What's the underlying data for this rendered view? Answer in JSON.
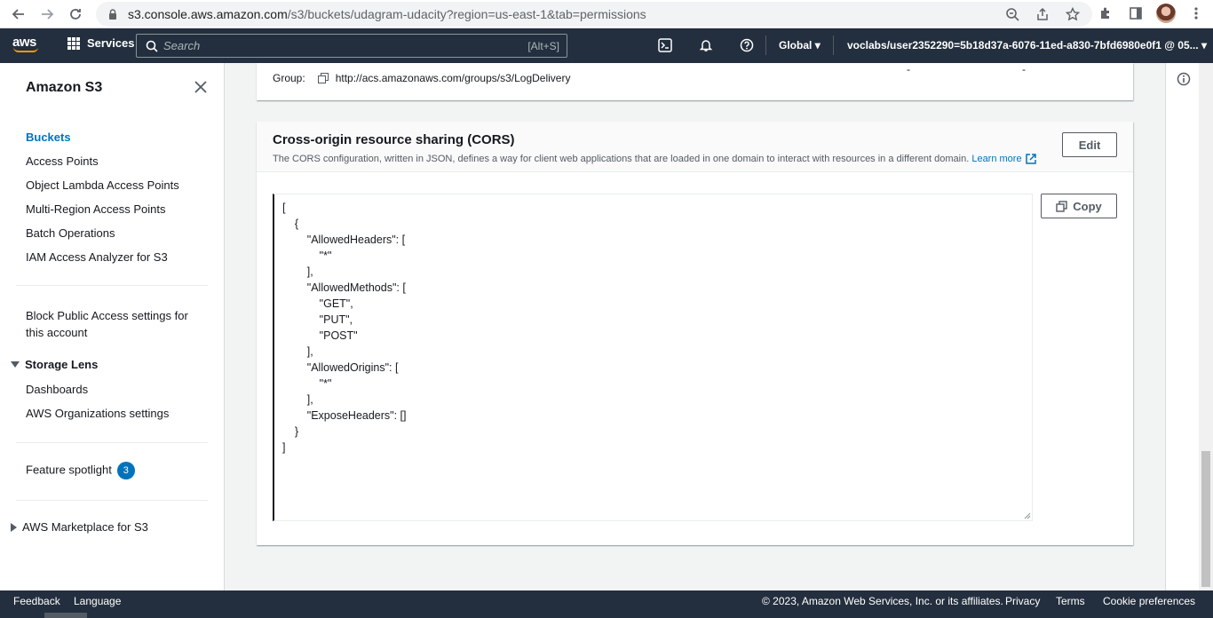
{
  "browser": {
    "url_host": "s3.console.aws.amazon.com",
    "url_rest": "/s3/buckets/udagram-udacity?region=us-east-1&tab=permissions"
  },
  "topnav": {
    "logo": "aws",
    "services_label": "Services",
    "search_placeholder": "Search",
    "search_shortcut": "[Alt+S]",
    "region_label": "Global",
    "account_label": "voclabs/user2352290=5b18d37a-6076-11ed-a830-7bfd6980e0f1 @ 05..."
  },
  "sidebar": {
    "title": "Amazon S3",
    "items": [
      {
        "label": "Buckets",
        "active": true
      },
      {
        "label": "Access Points"
      },
      {
        "label": "Object Lambda Access Points"
      },
      {
        "label": "Multi-Region Access Points"
      },
      {
        "label": "Batch Operations"
      },
      {
        "label": "IAM Access Analyzer for S3"
      }
    ],
    "block_public_line1": "Block Public Access settings for",
    "block_public_line2": "this account",
    "storage_lens_label": "Storage Lens",
    "storage_lens_items": [
      "Dashboards",
      "AWS Organizations settings"
    ],
    "feature_spotlight_label": "Feature spotlight",
    "feature_spotlight_count": "3",
    "marketplace_label": "AWS Marketplace for S3"
  },
  "grantee_card": {
    "group_label": "Group:",
    "group_uri": "http://acs.amazonaws.com/groups/s3/LogDelivery",
    "dash": "-"
  },
  "cors": {
    "title": "Cross-origin resource sharing (CORS)",
    "description": "The CORS configuration, written in JSON, defines a way for client web applications that are loaded in one domain to interact with resources in a different domain.",
    "learn_more": "Learn more",
    "edit_label": "Edit",
    "copy_label": "Copy",
    "code_lines": [
      "[",
      "    {",
      "        \"AllowedHeaders\": [",
      "            \"*\"",
      "        ],",
      "        \"AllowedMethods\": [",
      "            \"GET\",",
      "            \"PUT\",",
      "            \"POST\"",
      "        ],",
      "        \"AllowedOrigins\": [",
      "            \"*\"",
      "        ],",
      "        \"ExposeHeaders\": []",
      "    }",
      "]"
    ]
  },
  "footer": {
    "feedback": "Feedback",
    "language": "Language",
    "copyright": "© 2023, Amazon Web Services, Inc. or its affiliates.",
    "privacy": "Privacy",
    "terms": "Terms",
    "cookie": "Cookie preferences"
  },
  "colors": {
    "nav_bg": "#232f3e",
    "link": "#0073bb",
    "accent": "#ff9900"
  }
}
